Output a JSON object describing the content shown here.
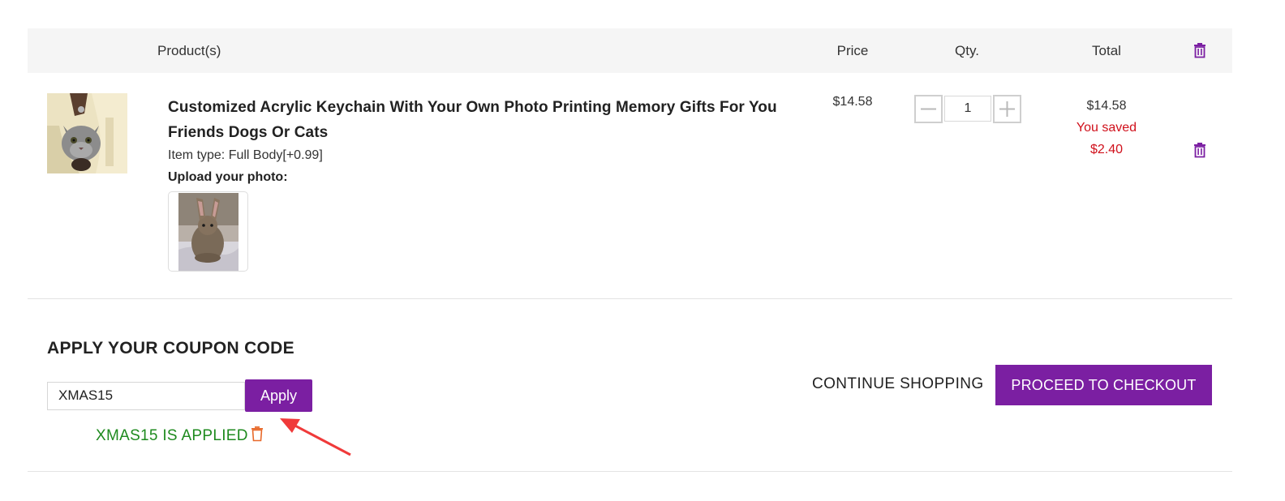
{
  "table_header": {
    "product": "Product(s)",
    "price": "Price",
    "qty": "Qty.",
    "total": "Total",
    "trash_icon": "trash-icon"
  },
  "item": {
    "title_line1": "Customized Acrylic Keychain With Your Own Photo Printing Memory Gifts For You",
    "title_line2": "Friends Dogs Or Cats",
    "item_type": "Item type: Full Body[+0.99]",
    "upload_label": "Upload your photo:",
    "price": "$14.58",
    "quantity": "1",
    "total": "$14.58",
    "saved_label": "You saved",
    "saved_value": "$2.40",
    "minus_icon": "minus-icon",
    "plus_icon": "plus-icon"
  },
  "coupon": {
    "title": "APPLY YOUR COUPON CODE",
    "code_value": "XMAS15",
    "apply_label": "Apply",
    "applied_message": "XMAS15 IS APPLIED"
  },
  "actions": {
    "continue_shopping": "CONTINUE SHOPPING",
    "checkout": "PROCEED TO CHECKOUT"
  },
  "colors": {
    "accent_purple": "#7b1fa2",
    "saved_red": "#d0101b",
    "applied_green": "#1e8a1e",
    "coupon_trash_orange": "#e8692a",
    "annotation_arrow_red": "#f03a3a"
  }
}
